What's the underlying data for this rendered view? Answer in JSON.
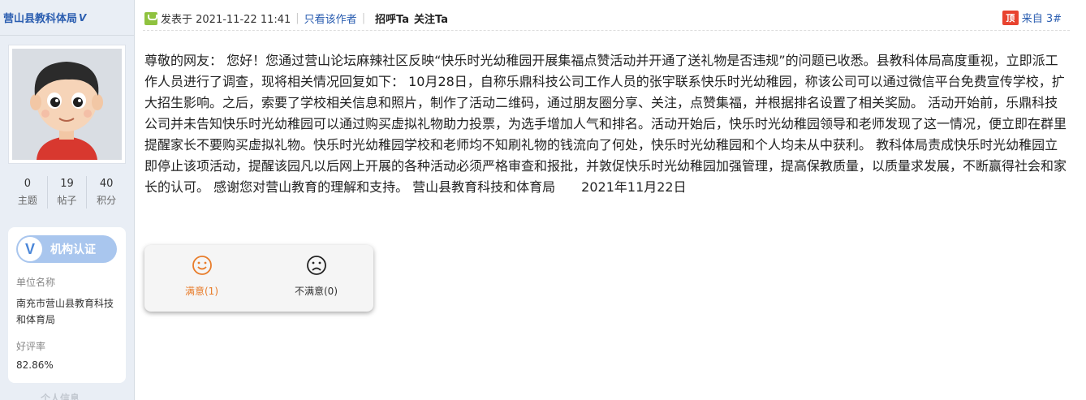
{
  "sidebar": {
    "username": "营山县教科体局",
    "verified_mark": "V",
    "stats": [
      {
        "value": "0",
        "label": "主题"
      },
      {
        "value": "19",
        "label": "帖子"
      },
      {
        "value": "40",
        "label": "积分"
      }
    ],
    "auth_label": "机构认证",
    "auth_icon_letter": "V",
    "unit_label": "单位名称",
    "unit_value": "南充市营山县教育科技和体育局",
    "rating_label": "好评率",
    "rating_value": "82.86%",
    "bottom_partial": "个人信息"
  },
  "post": {
    "posted_at": "发表于 2021-11-22 11:41",
    "only_author": "只看该作者",
    "greet": "招呼Ta",
    "follow": "关注Ta",
    "top_icon": "顶",
    "from_floor": "来自 3#",
    "body": "尊敬的网友： 您好！您通过营山论坛麻辣社区反映“快乐时光幼稚园开展集福点赞活动并开通了送礼物是否违规”的问题已收悉。县教科体局高度重视，立即派工作人员进行了调查，现将相关情况回复如下： 10月28日，自称乐鼎科技公司工作人员的张宇联系快乐时光幼稚园，称该公司可以通过微信平台免费宣传学校，扩大招生影响。之后，索要了学校相关信息和照片，制作了活动二维码，通过朋友圈分享、关注，点赞集福，并根据排名设置了相关奖励。 活动开始前，乐鼎科技公司并未告知快乐时光幼稚园可以通过购买虚拟礼物助力投票，为选手增加人气和排名。活动开始后，快乐时光幼稚园领导和老师发现了这一情况，便立即在群里提醒家长不要购买虚拟礼物。快乐时光幼稚园学校和老师均不知刷礼物的钱流向了何处，快乐时光幼稚园和个人均未从中获利。 教科体局责成快乐时光幼稚园立即停止该项活动，提醒该园凡以后网上开展的各种活动必须严格审查和报批，并敦促快乐时光幼稚园加强管理，提高保教质量，以质量求发展，不断赢得社会和家长的认可。 感谢您对营山教育的理解和支持。 营山县教育科技和体育局　　2021年11月22日"
  },
  "rating": {
    "good_label": "满意(1)",
    "bad_label": "不满意(0)"
  },
  "colors": {
    "accent_blue": "#2a5db0",
    "good_orange": "#e87c2a",
    "top_red": "#e8432f",
    "auth_blue": "#a9c6ee"
  }
}
